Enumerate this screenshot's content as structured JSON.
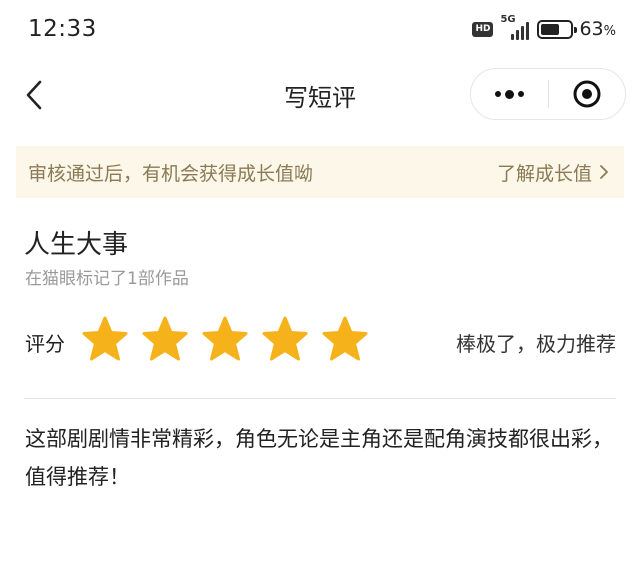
{
  "status_bar": {
    "time": "12:33",
    "hd": "HD",
    "network": "5G",
    "battery_percent": "63",
    "battery_unit": "%",
    "battery_level": 0.63
  },
  "nav": {
    "title": "写短评",
    "back_icon": "chevron-left-icon",
    "more_icon": "more-dots-icon",
    "close_icon": "target-close-icon"
  },
  "notice": {
    "text": "审核通过后，有机会获得成长值呦",
    "link": "了解成长值"
  },
  "work": {
    "title": "人生大事",
    "subtitle": "在猫眼标记了1部作品"
  },
  "rating": {
    "label": "评分",
    "stars_filled": 5,
    "stars_total": 5,
    "star_color": "#f5b21a",
    "description": "棒极了，极力推荐"
  },
  "review": {
    "text": "这部剧剧情非常精彩，角色无论是主角还是配角演技都很出彩，值得推荐！"
  }
}
